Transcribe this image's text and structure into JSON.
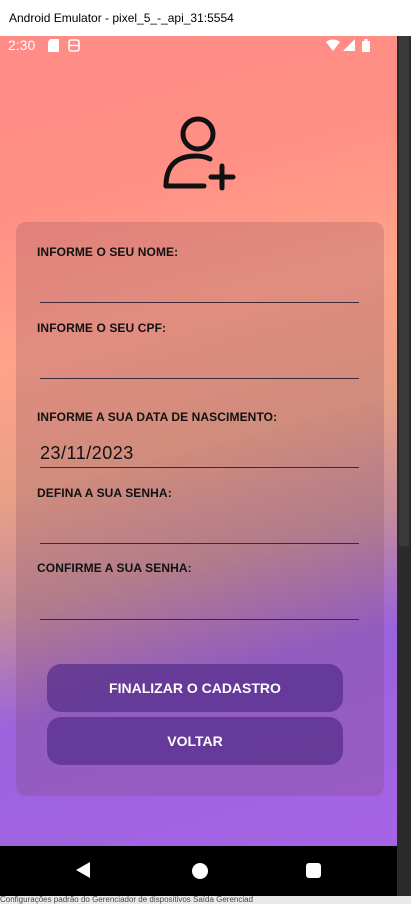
{
  "window": {
    "title": "Android Emulator - pixel_5_-_api_31:5554"
  },
  "status_bar": {
    "time": "2:30",
    "colors": {
      "text": "#ffffff"
    }
  },
  "form": {
    "fields": [
      {
        "label": "INFORME O SEU NOME:",
        "value": ""
      },
      {
        "label": "INFORME O SEU CPF:",
        "value": ""
      },
      {
        "label": "INFORME A SUA DATA DE NASCIMENTO:",
        "value": "23/11/2023"
      },
      {
        "label": "DEFINA A SUA SENHA:",
        "value": ""
      },
      {
        "label": "CONFIRME A SUA SENHA:",
        "value": ""
      }
    ],
    "buttons": {
      "finish": "FINALIZAR O CADASTRO",
      "back": "VOLTAR"
    }
  },
  "icons": {
    "header": "add-user-icon",
    "nav": [
      "nav-back-icon",
      "nav-home-icon",
      "nav-recent-apps-icon"
    ]
  },
  "taskbar_text": "Configurações padrão do Gerenciador de dispositivos Saída    Gerenciad",
  "colors": {
    "gradient_top": "#ff8b86",
    "gradient_bottom": "#a864e6",
    "button": "#542e8a"
  }
}
